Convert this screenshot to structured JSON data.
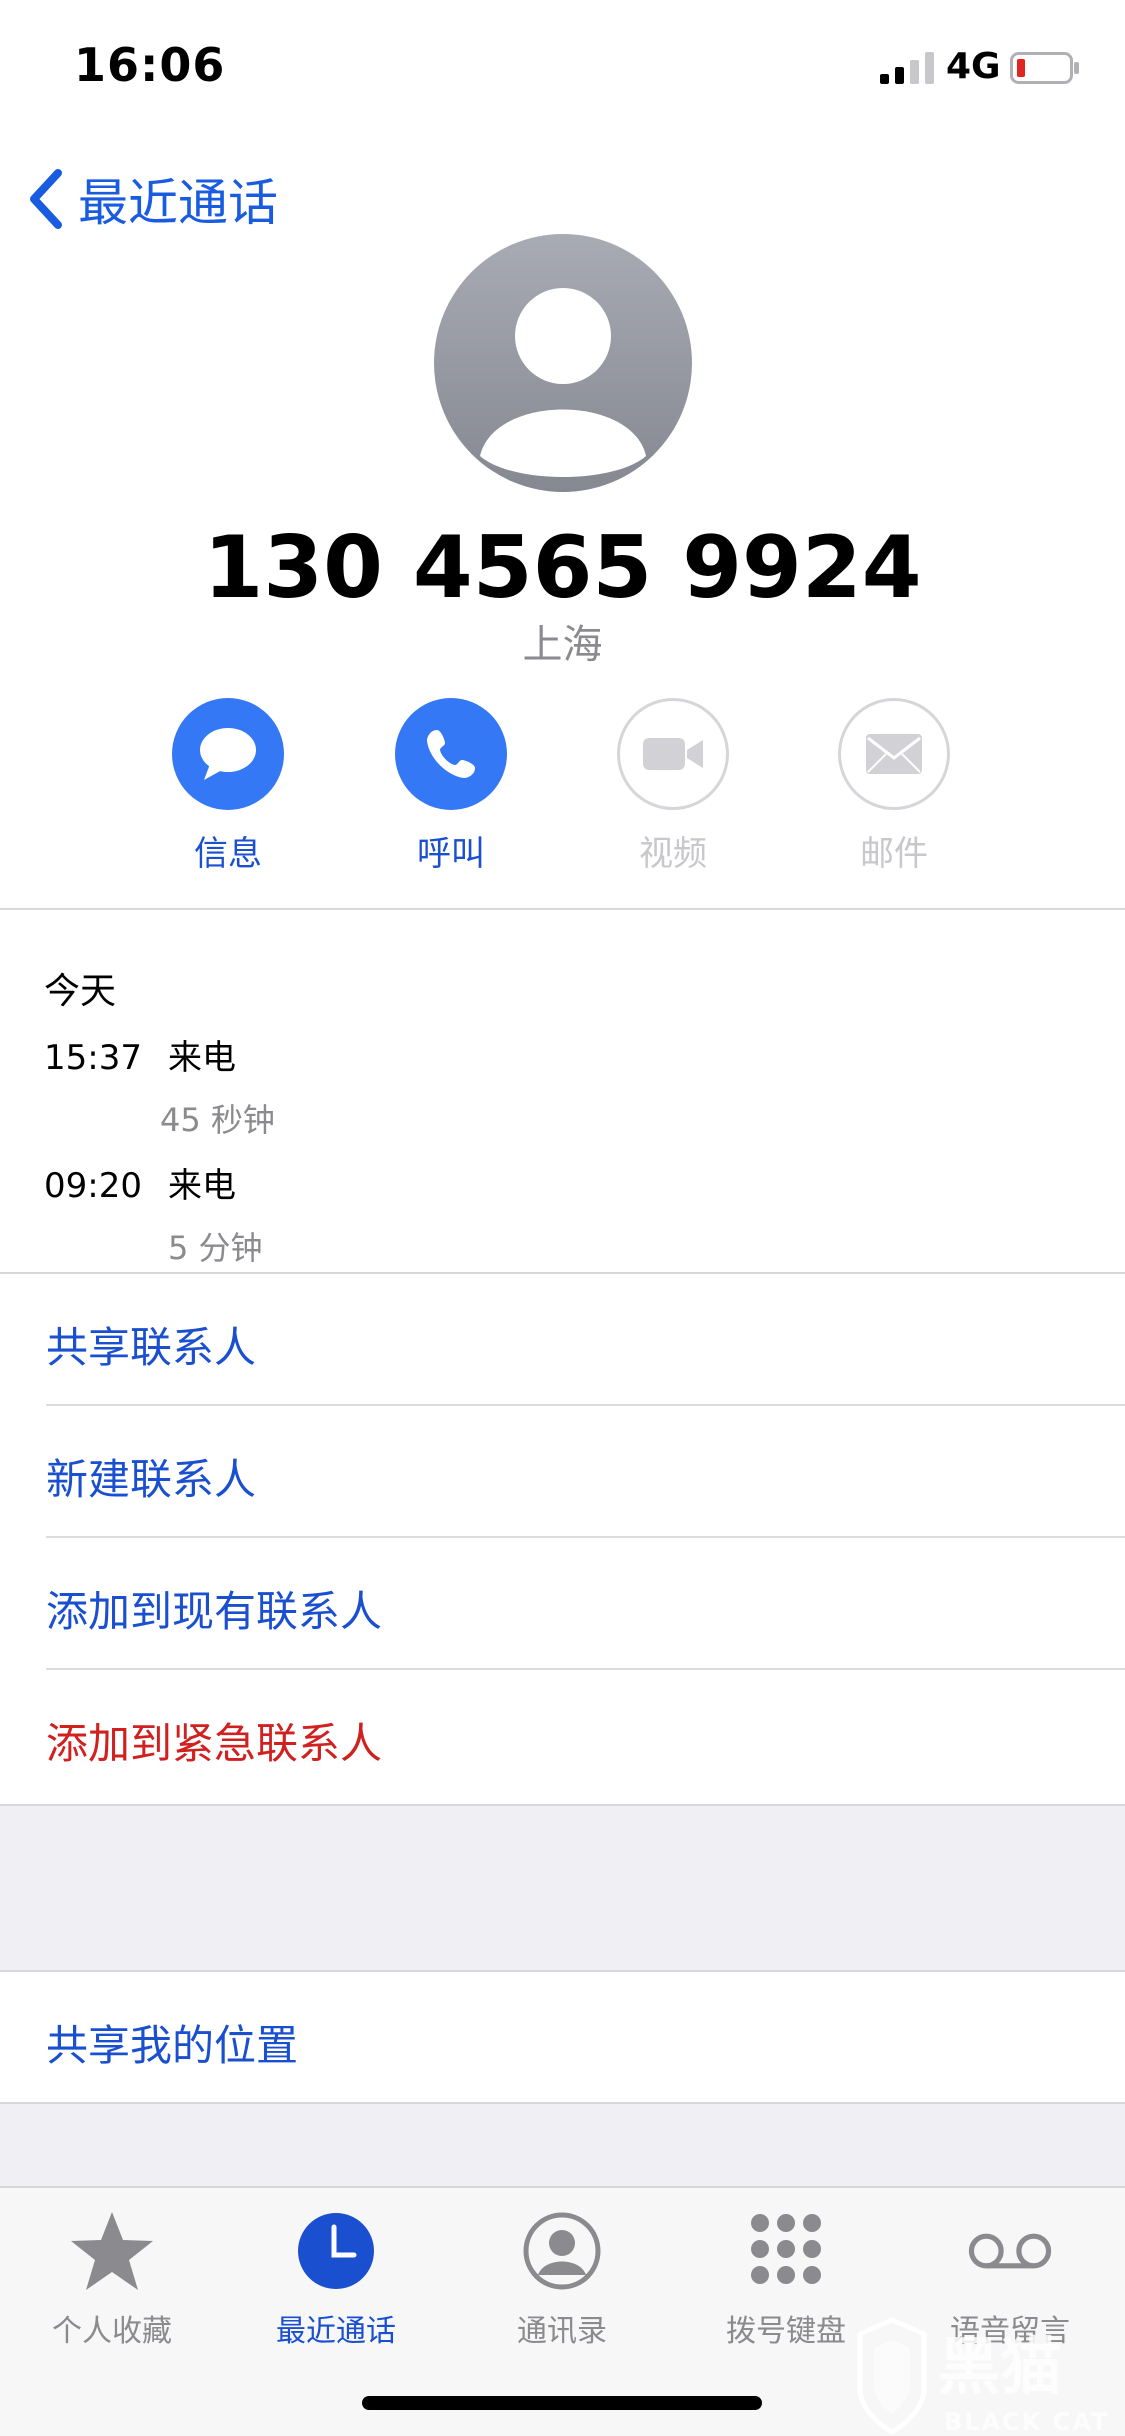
{
  "status": {
    "time": "16:06",
    "network": "4G"
  },
  "nav": {
    "back_label": "最近通话"
  },
  "contact": {
    "phone": "130 4565 9924",
    "region": "上海"
  },
  "actions": [
    {
      "label": "信息",
      "icon": "message-icon",
      "enabled": true
    },
    {
      "label": "呼叫",
      "icon": "phone-icon",
      "enabled": true
    },
    {
      "label": "视频",
      "icon": "video-icon",
      "enabled": false
    },
    {
      "label": "邮件",
      "icon": "mail-icon",
      "enabled": false
    }
  ],
  "history": {
    "day": "今天",
    "calls": [
      {
        "time": "15:37",
        "type": "来电",
        "duration": "45 秒钟"
      },
      {
        "time": "09:20",
        "type": "来电",
        "duration": "5 分钟"
      }
    ]
  },
  "options": [
    {
      "label": "共享联系人"
    },
    {
      "label": "新建联系人"
    },
    {
      "label": "添加到现有联系人"
    },
    {
      "label": "添加到紧急联系人"
    }
  ],
  "location": {
    "label": "共享我的位置"
  },
  "tabs": [
    {
      "label": "个人收藏",
      "icon": "star-icon"
    },
    {
      "label": "最近通话",
      "icon": "clock-icon",
      "active": true
    },
    {
      "label": "通讯录",
      "icon": "contacts-icon"
    },
    {
      "label": "拨号键盘",
      "icon": "keypad-icon"
    },
    {
      "label": "语音留言",
      "icon": "voicemail-icon"
    }
  ],
  "colors": {
    "accent": "#1a4fd0",
    "action_blue": "#3478f6",
    "danger": "#d0201f",
    "secondary": "#8a8a8f"
  },
  "watermark": {
    "text": "黑猫",
    "subtext": "BLACK CAT"
  }
}
